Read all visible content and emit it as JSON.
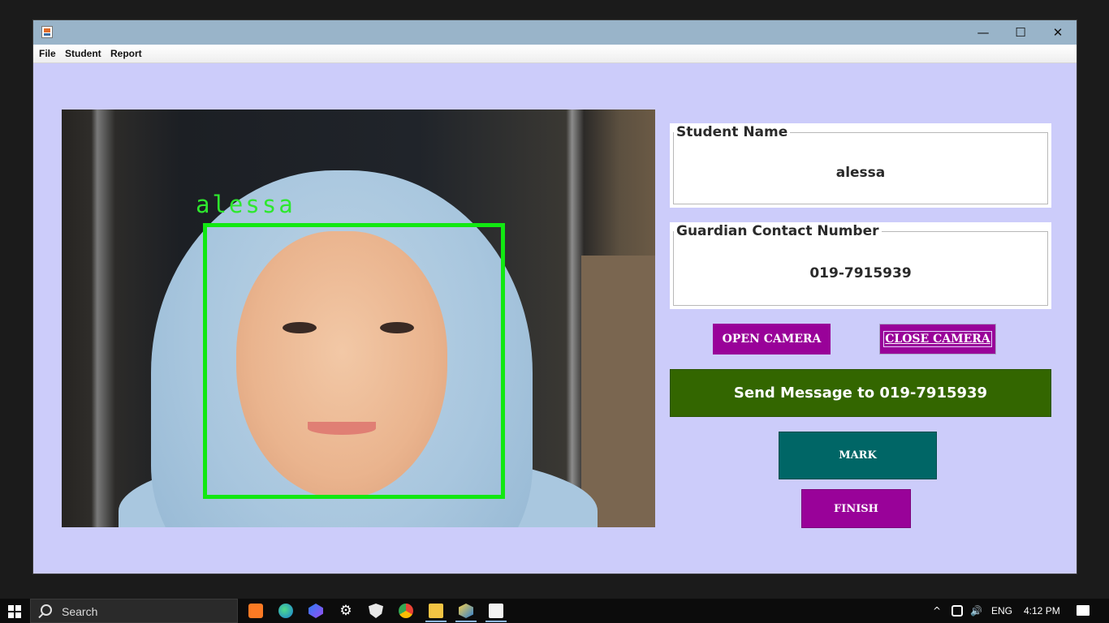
{
  "window": {
    "minimize_glyph": "—",
    "maximize_glyph": "☐",
    "close_glyph": "✕"
  },
  "menu": {
    "items": [
      "File",
      "Student",
      "Report"
    ]
  },
  "camera": {
    "face_label": "alessa",
    "box_color": "#12e812"
  },
  "student": {
    "name_title": "Student Name",
    "name_value": "alessa",
    "contact_title": "Guardian Contact Number",
    "contact_value": "019-7915939"
  },
  "buttons": {
    "open_camera": "OPEN CAMERA",
    "close_camera": "CLOSE CAMERA",
    "send_message": "Send Message to 019-7915939",
    "mark": "MARK",
    "finish": "FINISH"
  },
  "colors": {
    "window_bg": "#ccccfa",
    "purple": "#990299",
    "green": "#336600",
    "teal": "#006666"
  },
  "taskbar": {
    "search_placeholder": "Search",
    "pinned_icons": [
      "xampp-icon",
      "edge-icon",
      "copilot-icon",
      "settings-icon",
      "security-icon",
      "chrome-icon",
      "file-explorer-icon",
      "netbeans-icon",
      "java-icon"
    ],
    "language": "ENG",
    "time": "4:12 PM"
  }
}
